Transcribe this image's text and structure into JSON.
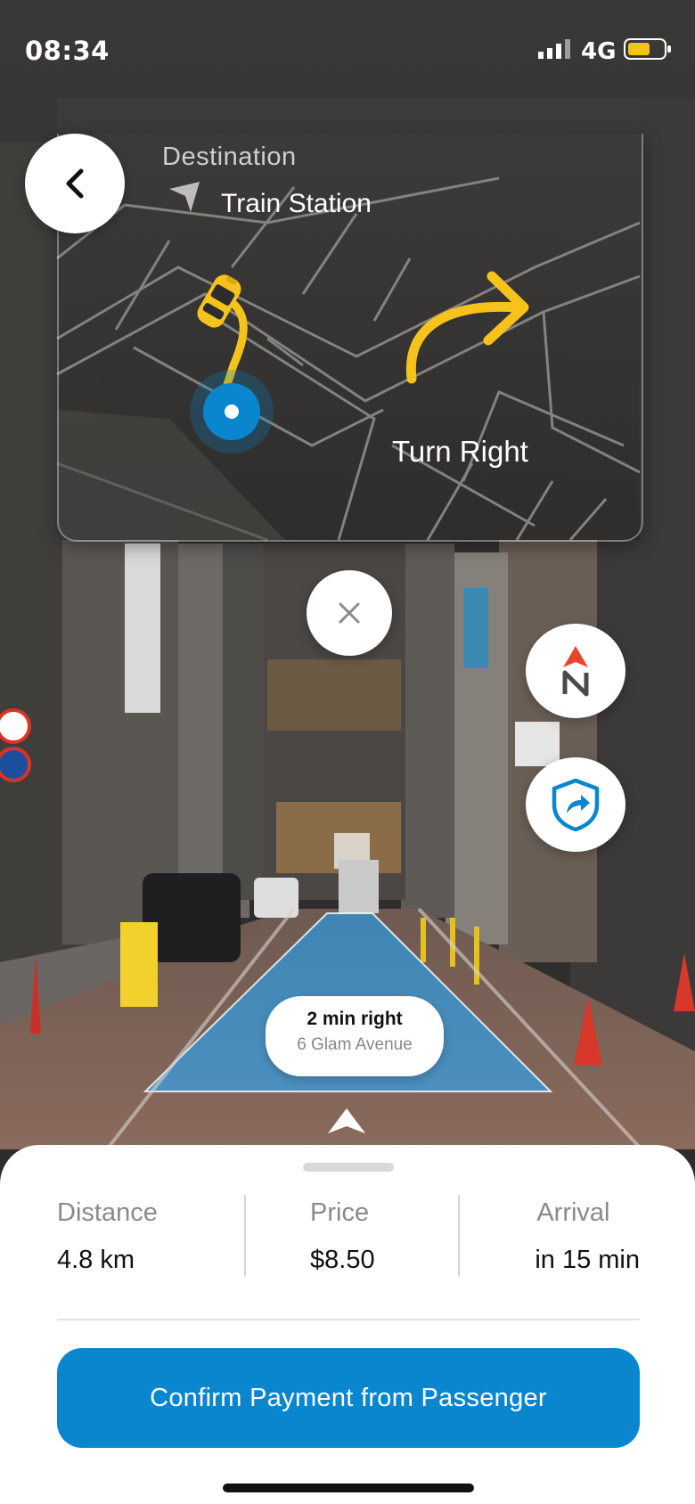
{
  "status_bar": {
    "time": "08:34",
    "network": "4G"
  },
  "navigation": {
    "destination_label": "Destination",
    "destination_value": "Train Station",
    "instruction": "Turn Right"
  },
  "route_tip": {
    "title": "2 min right",
    "subtitle": "6 Glam Avenue"
  },
  "trip": {
    "distance": {
      "label": "Distance",
      "value": "4.8 km"
    },
    "price": {
      "label": "Price",
      "value": "$8.50"
    },
    "arrival": {
      "label": "Arrival",
      "value": "in 15 min"
    }
  },
  "actions": {
    "confirm_label": "Confirm Payment from Passenger"
  },
  "icons": {
    "back": "chevron-left-icon",
    "close": "close-icon",
    "compass": "north-compass-icon",
    "shield": "shield-share-icon",
    "destination": "navigation-arrow-icon",
    "turn": "turn-right-arrow-icon",
    "car": "taxi-car-icon",
    "location": "current-location-icon"
  },
  "colors": {
    "accent": "#0a86cf",
    "route": "#f6c21c",
    "battery": "#f6c21c",
    "compass_red": "#e8452d"
  }
}
